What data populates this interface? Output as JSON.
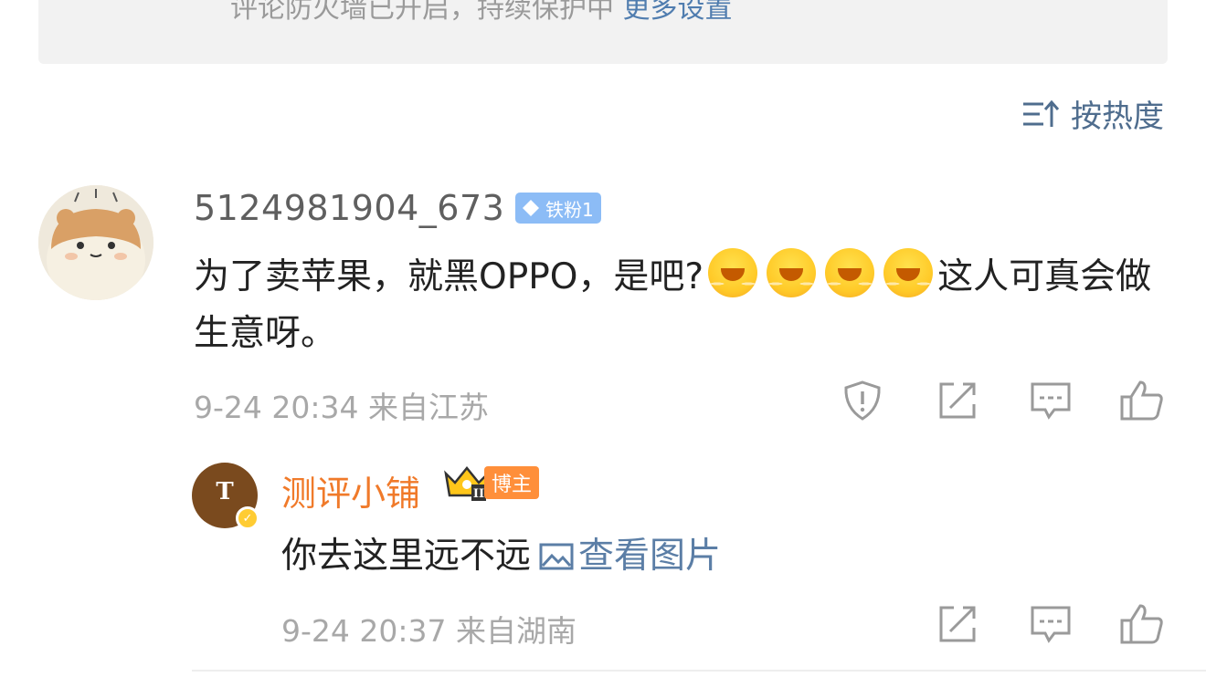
{
  "banner": {
    "text": "评论防火墙已开启，持续保护中",
    "link": "更多设置"
  },
  "sort": {
    "label": "按热度"
  },
  "comment": {
    "username": "5124981904_673",
    "fan_badge": "铁粉1",
    "text_before_emoji": "为了卖苹果，就黑OPPO，是吧?",
    "emoji_count": 4,
    "emoji_name": "hug-emoji",
    "text_after_emoji": "这人可真会做生意呀。",
    "time": "9-24 20:34",
    "location": "来自江苏"
  },
  "reply": {
    "username": "测评小铺",
    "role_badge": "博主",
    "crown_level": "II",
    "avatar_letter": "T",
    "text": "你去这里远不远",
    "view_image": "查看图片",
    "time": "9-24 20:37",
    "location": "来自湖南"
  },
  "colors": {
    "link": "#507daf",
    "username": "#5f5f5f",
    "blogger_name": "#f07a2a",
    "fan_badge": "#8cbcf6",
    "blogger_badge": "#ff8f3a",
    "meta": "#a8a8a8"
  }
}
